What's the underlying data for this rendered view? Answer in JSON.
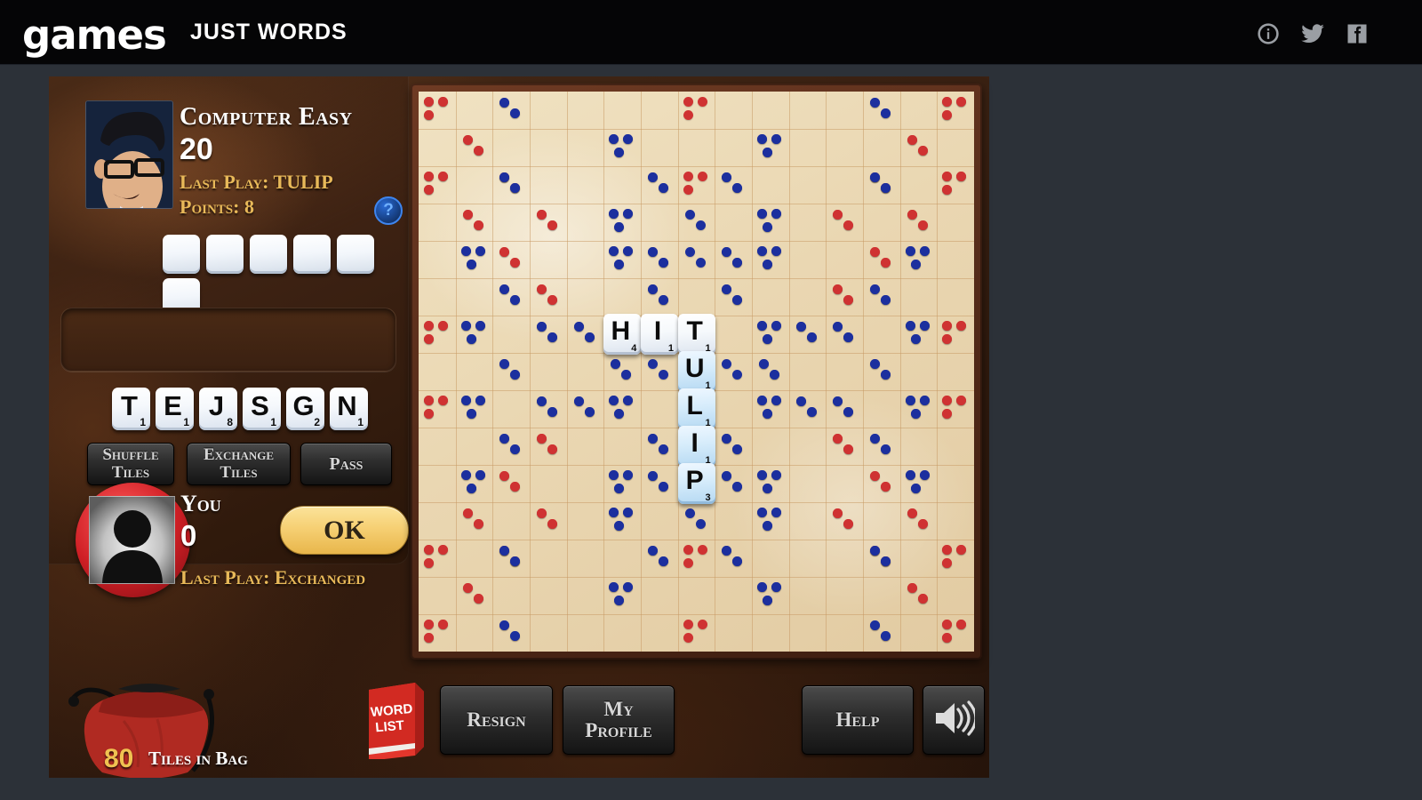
{
  "header": {
    "logo": "games",
    "title": "JUST WORDS",
    "icons": [
      {
        "name": "info-icon",
        "label": "Info"
      },
      {
        "name": "twitter-icon",
        "label": "Twitter"
      },
      {
        "name": "facebook-icon",
        "label": "Facebook"
      }
    ]
  },
  "opponent": {
    "name": "Computer Easy",
    "score": "20",
    "last_play": "Last Play: TULIP",
    "points": "Points: 8",
    "help_badge": "?",
    "rack_blank_count": 6
  },
  "player": {
    "name": "You",
    "score": "0",
    "last_play": "Last Play: Exchanged",
    "ok_label": "OK",
    "rack": [
      {
        "letter": "T",
        "value": "1"
      },
      {
        "letter": "E",
        "value": "1"
      },
      {
        "letter": "J",
        "value": "8"
      },
      {
        "letter": "S",
        "value": "1"
      },
      {
        "letter": "G",
        "value": "2"
      },
      {
        "letter": "N",
        "value": "1"
      }
    ]
  },
  "actions": {
    "shuffle": "Shuffle Tiles",
    "shuffle_line1": "Shuffle",
    "shuffle_line2": "Tiles",
    "exchange_line1": "Exchange",
    "exchange_line2": "Tiles",
    "pass": "Pass",
    "resign": "Resign",
    "profile_line1": "My",
    "profile_line2": "Profile",
    "help": "Help",
    "sound": "Sound"
  },
  "bag": {
    "count": "80",
    "label": "Tiles in Bag"
  },
  "wordlist": {
    "line1": "Word",
    "line2": "List"
  },
  "colors": {
    "triple_word": "#cf3232",
    "double_word": "#cf3232",
    "triple_letter": "#1c2f9e",
    "double_letter": "#1c2f9e",
    "accent_gold": "#e8b959",
    "ok_button": "#f6d074",
    "board_bg": "#ead7b2"
  },
  "board": {
    "size": 15,
    "legend": {
      "red_three_dots": "triple word",
      "red_two_dots": "double word",
      "blue_three_dots": "triple letter",
      "blue_two_dots": "double letter"
    },
    "bonus": [
      {
        "r": 0,
        "c": 0,
        "t": "tw"
      },
      {
        "r": 0,
        "c": 2,
        "t": "dl"
      },
      {
        "r": 0,
        "c": 7,
        "t": "tw"
      },
      {
        "r": 0,
        "c": 12,
        "t": "dl"
      },
      {
        "r": 0,
        "c": 14,
        "t": "tw"
      },
      {
        "r": 1,
        "c": 1,
        "t": "dw"
      },
      {
        "r": 1,
        "c": 5,
        "t": "tl"
      },
      {
        "r": 1,
        "c": 9,
        "t": "tl"
      },
      {
        "r": 1,
        "c": 13,
        "t": "dw"
      },
      {
        "r": 2,
        "c": 2,
        "t": "dw"
      },
      {
        "r": 2,
        "c": 6,
        "t": "dl"
      },
      {
        "r": 2,
        "c": 8,
        "t": "dl"
      },
      {
        "r": 2,
        "c": 12,
        "t": "dw"
      },
      {
        "r": 3,
        "c": 3,
        "t": "dw"
      },
      {
        "r": 3,
        "c": 7,
        "t": "dl"
      },
      {
        "r": 3,
        "c": 11,
        "t": "dw"
      },
      {
        "r": 4,
        "c": 1,
        "t": "tl"
      },
      {
        "r": 4,
        "c": 5,
        "t": "tl"
      },
      {
        "r": 4,
        "c": 9,
        "t": "tl"
      },
      {
        "r": 4,
        "c": 13,
        "t": "tl"
      },
      {
        "r": 5,
        "c": 2,
        "t": "dl"
      },
      {
        "r": 5,
        "c": 6,
        "t": "dl"
      },
      {
        "r": 5,
        "c": 8,
        "t": "dl"
      },
      {
        "r": 5,
        "c": 12,
        "t": "dl"
      },
      {
        "r": 6,
        "c": 0,
        "t": "tw"
      },
      {
        "r": 6,
        "c": 3,
        "t": "dl"
      },
      {
        "r": 6,
        "c": 4,
        "t": "dl"
      },
      {
        "r": 6,
        "c": 10,
        "t": "dl"
      },
      {
        "r": 6,
        "c": 11,
        "t": "dl"
      },
      {
        "r": 6,
        "c": 14,
        "t": "tw"
      },
      {
        "r": 7,
        "c": 2,
        "t": "dl"
      },
      {
        "r": 7,
        "c": 5,
        "t": "dl"
      },
      {
        "r": 7,
        "c": 6,
        "t": "dl"
      },
      {
        "r": 7,
        "c": 9,
        "t": "dl"
      },
      {
        "r": 7,
        "c": 12,
        "t": "dl"
      },
      {
        "r": 8,
        "c": 1,
        "t": "tl"
      },
      {
        "r": 8,
        "c": 5,
        "t": "tl"
      },
      {
        "r": 8,
        "c": 9,
        "t": "tl"
      },
      {
        "r": 8,
        "c": 13,
        "t": "tl"
      },
      {
        "r": 9,
        "c": 3,
        "t": "dw"
      },
      {
        "r": 9,
        "c": 11,
        "t": "dw"
      },
      {
        "r": 10,
        "c": 2,
        "t": "dw"
      },
      {
        "r": 10,
        "c": 6,
        "t": "dl"
      },
      {
        "r": 10,
        "c": 7,
        "t": "dl"
      },
      {
        "r": 10,
        "c": 8,
        "t": "dl"
      },
      {
        "r": 10,
        "c": 12,
        "t": "dw"
      },
      {
        "r": 11,
        "c": 1,
        "t": "dw"
      },
      {
        "r": 11,
        "c": 5,
        "t": "tl"
      },
      {
        "r": 11,
        "c": 9,
        "t": "tl"
      },
      {
        "r": 11,
        "c": 13,
        "t": "dw"
      },
      {
        "r": 12,
        "c": 0,
        "t": "tw"
      },
      {
        "r": 12,
        "c": 2,
        "t": "dl"
      },
      {
        "r": 12,
        "c": 7,
        "t": "tw"
      },
      {
        "r": 12,
        "c": 12,
        "t": "dl"
      },
      {
        "r": 12,
        "c": 14,
        "t": "tw"
      }
    ],
    "tiles": [
      {
        "r": 6,
        "c": 5,
        "letter": "H",
        "value": "4",
        "state": "old"
      },
      {
        "r": 6,
        "c": 6,
        "letter": "I",
        "value": "1",
        "state": "old"
      },
      {
        "r": 6,
        "c": 7,
        "letter": "T",
        "value": "1",
        "state": "old"
      },
      {
        "r": 7,
        "c": 7,
        "letter": "U",
        "value": "1",
        "state": "new"
      },
      {
        "r": 8,
        "c": 7,
        "letter": "L",
        "value": "1",
        "state": "new"
      },
      {
        "r": 9,
        "c": 7,
        "letter": "I",
        "value": "1",
        "state": "new"
      },
      {
        "r": 10,
        "c": 7,
        "letter": "P",
        "value": "3",
        "state": "new"
      }
    ]
  }
}
